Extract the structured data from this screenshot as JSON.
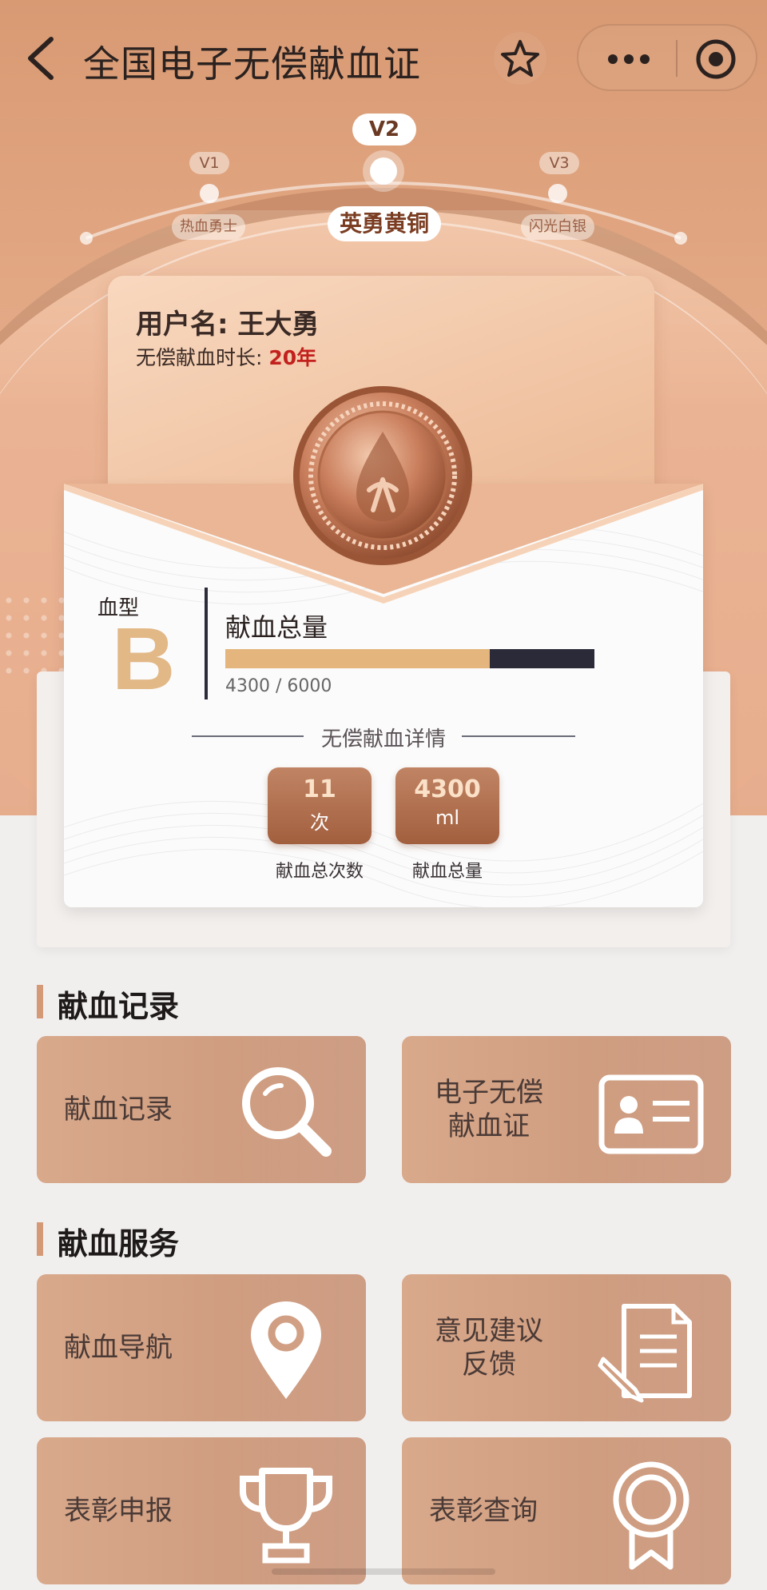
{
  "header": {
    "title": "全国电子无偿献血证"
  },
  "levels": {
    "current_code": "V2",
    "current_name": "英勇黄铜",
    "prev": {
      "code": "V1",
      "name": "热血勇士"
    },
    "next": {
      "code": "V3",
      "name": "闪光白银"
    }
  },
  "card": {
    "user_name": "用户名: 王大勇",
    "duration_label": "无偿献血时长:",
    "duration_value": "20年",
    "blood_type_label": "血型",
    "blood_type": "B",
    "volume_label": "献血总量",
    "volume_progress": 0.7167,
    "volume_text": "4300 / 6000",
    "detail_title": "无偿献血详情",
    "stats": [
      {
        "value": "11",
        "unit": "次",
        "label": "献血总次数"
      },
      {
        "value": "4300",
        "unit": "ml",
        "label": "献血总量"
      }
    ]
  },
  "sections": [
    {
      "title": "献血记录",
      "tiles": [
        {
          "label": "献血记录",
          "icon": "magnifier-icon"
        },
        {
          "label": "电子无偿献血证",
          "icon": "id-card-icon"
        }
      ]
    },
    {
      "title": "献血服务",
      "tiles": [
        {
          "label": "献血导航",
          "icon": "location-pin-icon"
        },
        {
          "label": "意见建议反馈",
          "icon": "document-pen-icon"
        },
        {
          "label": "表彰申报",
          "icon": "trophy-icon"
        },
        {
          "label": "表彰查询",
          "icon": "award-ribbon-icon"
        }
      ]
    }
  ],
  "colors": {
    "accent": "#d49a78",
    "progress_fill": "#e4b57d",
    "progress_track": "#2b2a38",
    "highlight": "#c2211d"
  }
}
